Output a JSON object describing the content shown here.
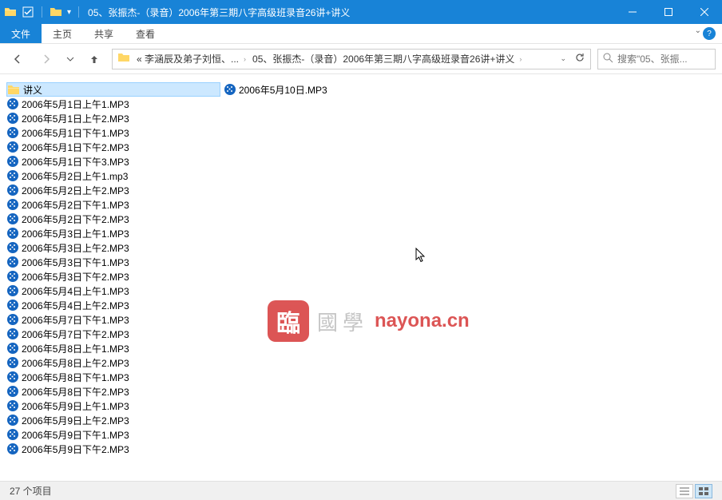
{
  "titlebar": {
    "title": "05、张振杰-（录音）2006年第三期八字高级班录音26讲+讲义"
  },
  "ribbon": {
    "tabs": [
      "文件",
      "主页",
      "共享",
      "查看"
    ]
  },
  "nav": {
    "breadcrumbs": [
      "« 李涵辰及弟子刘恒、...",
      "05、张振杰-（录音）2006年第三期八字高级班录音26讲+讲义"
    ],
    "search_placeholder": "搜索\"05、张振..."
  },
  "files": {
    "column1": [
      {
        "name": "讲义",
        "type": "folder",
        "selected": true
      },
      {
        "name": "2006年5月1日上午1.MP3",
        "type": "mp3"
      },
      {
        "name": "2006年5月1日上午2.MP3",
        "type": "mp3"
      },
      {
        "name": "2006年5月1日下午1.MP3",
        "type": "mp3"
      },
      {
        "name": "2006年5月1日下午2.MP3",
        "type": "mp3"
      },
      {
        "name": "2006年5月1日下午3.MP3",
        "type": "mp3"
      },
      {
        "name": "2006年5月2日上午1.mp3",
        "type": "mp3"
      },
      {
        "name": "2006年5月2日上午2.MP3",
        "type": "mp3"
      },
      {
        "name": "2006年5月2日下午1.MP3",
        "type": "mp3"
      },
      {
        "name": "2006年5月2日下午2.MP3",
        "type": "mp3"
      },
      {
        "name": "2006年5月3日上午1.MP3",
        "type": "mp3"
      },
      {
        "name": "2006年5月3日上午2.MP3",
        "type": "mp3"
      },
      {
        "name": "2006年5月3日下午1.MP3",
        "type": "mp3"
      },
      {
        "name": "2006年5月3日下午2.MP3",
        "type": "mp3"
      },
      {
        "name": "2006年5月4日上午1.MP3",
        "type": "mp3"
      },
      {
        "name": "2006年5月4日上午2.MP3",
        "type": "mp3"
      },
      {
        "name": "2006年5月7日下午1.MP3",
        "type": "mp3"
      },
      {
        "name": "2006年5月7日下午2.MP3",
        "type": "mp3"
      },
      {
        "name": "2006年5月8日上午1.MP3",
        "type": "mp3"
      },
      {
        "name": "2006年5月8日上午2.MP3",
        "type": "mp3"
      },
      {
        "name": "2006年5月8日下午1.MP3",
        "type": "mp3"
      },
      {
        "name": "2006年5月8日下午2.MP3",
        "type": "mp3"
      },
      {
        "name": "2006年5月9日上午1.MP3",
        "type": "mp3"
      },
      {
        "name": "2006年5月9日上午2.MP3",
        "type": "mp3"
      },
      {
        "name": "2006年5月9日下午1.MP3",
        "type": "mp3"
      },
      {
        "name": "2006年5月9日下午2.MP3",
        "type": "mp3"
      }
    ],
    "column2": [
      {
        "name": "2006年5月10日.MP3",
        "type": "mp3"
      }
    ]
  },
  "statusbar": {
    "item_count": "27 个项目"
  },
  "watermark": {
    "badge": "臨",
    "text1": "國學",
    "text2": "nayona.cn"
  }
}
